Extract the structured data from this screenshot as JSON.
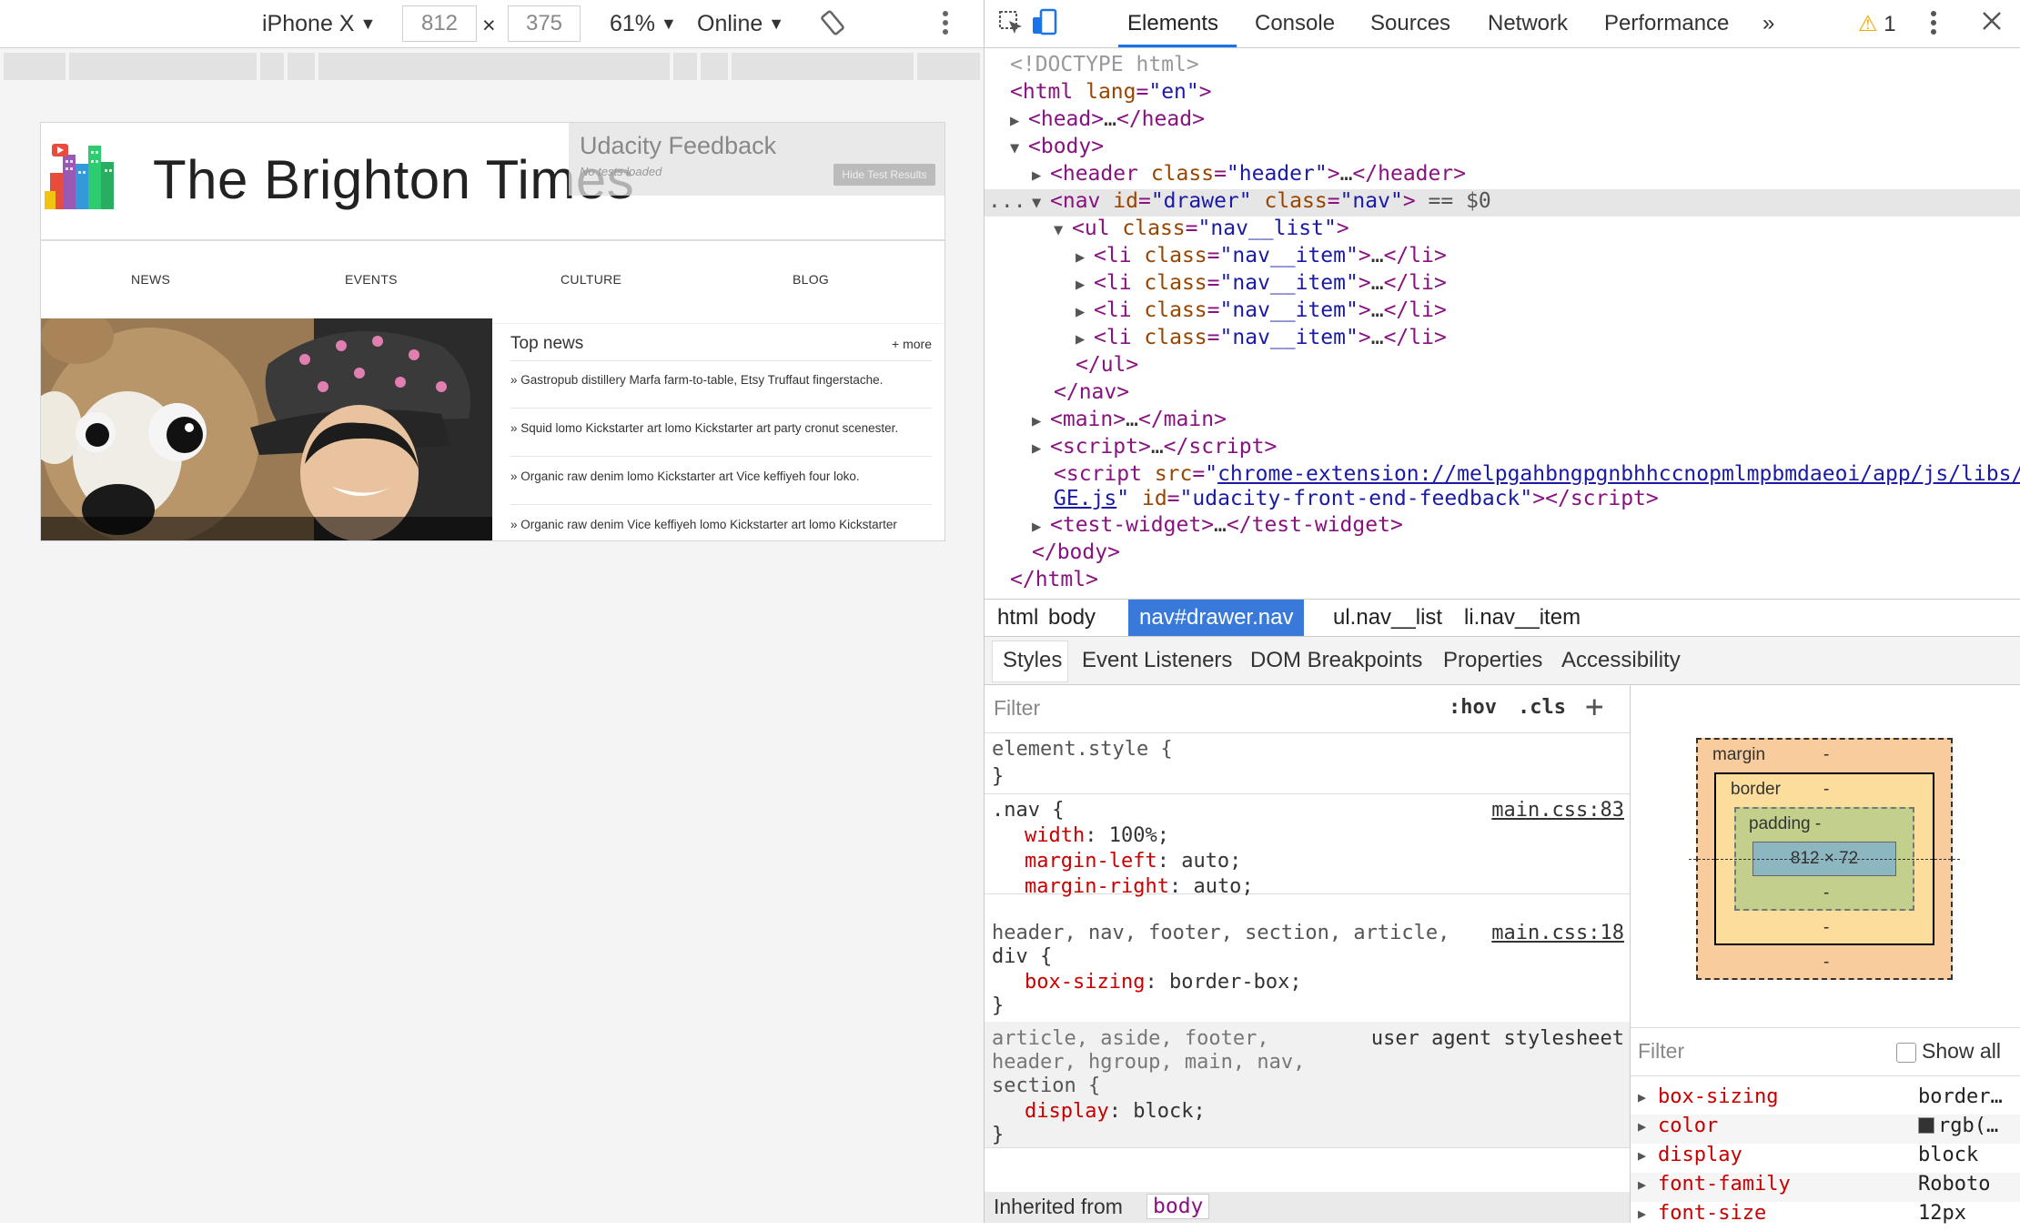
{
  "device_toolbar": {
    "device": "iPhone X",
    "width": "812",
    "times": "×",
    "height": "375",
    "zoom": "61%",
    "network": "Online"
  },
  "site": {
    "title": "The Brighton Times",
    "feedback_title": "Udacity Feedback",
    "feedback_status": "No tests loaded",
    "feedback_button": "Hide Test Results",
    "nav": [
      "NEWS",
      "EVENTS",
      "CULTURE",
      "BLOG"
    ],
    "top_news_title": "Top news",
    "top_news_more": "+ more",
    "news": [
      "» Gastropub distillery Marfa farm-to-table, Etsy Truffaut fingerstache.",
      "» Squid lomo Kickstarter art lomo Kickstarter art party cronut scenester.",
      "» Organic raw denim lomo Kickstarter art Vice keffiyeh four loko.",
      "» Organic raw denim Vice keffiyeh lomo Kickstarter art lomo Kickstarter"
    ]
  },
  "devtools": {
    "tabs": [
      "Elements",
      "Console",
      "Sources",
      "Network",
      "Performance"
    ],
    "overflow": "»",
    "warning_count": "1",
    "tree": {
      "doctype": "<!DOCTYPE html>",
      "html_tag": "html",
      "lang_attr": "lang",
      "lang_val": "\"en\"",
      "head": "head",
      "body": "body",
      "header_tag": "header",
      "class_attr": "class",
      "header_class": "\"header\"",
      "nav_tag": "nav",
      "id_attr": "id",
      "nav_id": "\"drawer\"",
      "nav_class": "\"nav\"",
      "selected_marker": "== $0",
      "ul_tag": "ul",
      "ul_class": "\"nav__list\"",
      "li_tag": "li",
      "li_class": "\"nav__item\"",
      "main": "main",
      "script": "script",
      "src_attr": "src",
      "script_src_1": "chrome-extension://melpgahbngpgnbhhccnopmlmpbmdaeoi/app/js/libs/",
      "script_src_2": "GE.js",
      "script_id": "\"udacity-front-end-feedback\"",
      "test_widget": "test-widget",
      "ellipsis": "…",
      "dots": "..."
    },
    "breadcrumbs": [
      "html",
      "body",
      "nav#drawer.nav",
      "ul.nav__list",
      "li.nav__item"
    ],
    "sub_tabs": [
      "Styles",
      "Event Listeners",
      "DOM Breakpoints",
      "Properties",
      "Accessibility"
    ],
    "styles": {
      "filter_placeholder": "Filter",
      "hov": ":hov",
      "cls": ".cls",
      "plus": "+",
      "element_style": "element.style {",
      "close": "}",
      "rule1_selector": ".nav {",
      "rule1_source": "main.css:83",
      "rule1_props": [
        {
          "name": "width",
          "value": " 100%;"
        },
        {
          "name": "margin-left",
          "value": " auto;"
        },
        {
          "name": "margin-right",
          "value": " auto;"
        }
      ],
      "rule2_selector_1": "header, nav, footer, section, article,",
      "rule2_selector_2": "div {",
      "rule2_source": "main.css:18",
      "rule2_props": [
        {
          "name": "box-sizing",
          "value": " border-box;"
        }
      ],
      "rule3_selector_1": "article, aside, footer,",
      "rule3_selector_2": "header, hgroup, main, nav,",
      "rule3_selector_3": "section {",
      "rule3_source": "user agent stylesheet",
      "rule3_props": [
        {
          "name": "display",
          "value": " block;"
        }
      ],
      "inherited_label": "Inherited from",
      "inherited_from": "body"
    },
    "box_model": {
      "margin_label": "margin",
      "border_label": "border",
      "padding_label": "padding",
      "dash": "-",
      "content": "812 × 72"
    },
    "computed": {
      "filter_placeholder": "Filter",
      "show_all": "Show all",
      "props": [
        {
          "name": "box-sizing",
          "value": "border…"
        },
        {
          "name": "color",
          "value": "rgb(…"
        },
        {
          "name": "display",
          "value": "block"
        },
        {
          "name": "font-family",
          "value": "Roboto"
        },
        {
          "name": "font-size",
          "value": "12px"
        }
      ]
    }
  },
  "colors": {
    "accent": "#1a73e8",
    "breadcrumb_active": "#3879d9",
    "tag": "#881280",
    "attr_name": "#994500",
    "attr_value": "#1a1aa6",
    "css_prop": "#c80000",
    "box_margin": "#f9cc9d",
    "box_border": "#fddd9b",
    "box_padding": "#c3d08b",
    "box_content": "#8cb6c0"
  }
}
